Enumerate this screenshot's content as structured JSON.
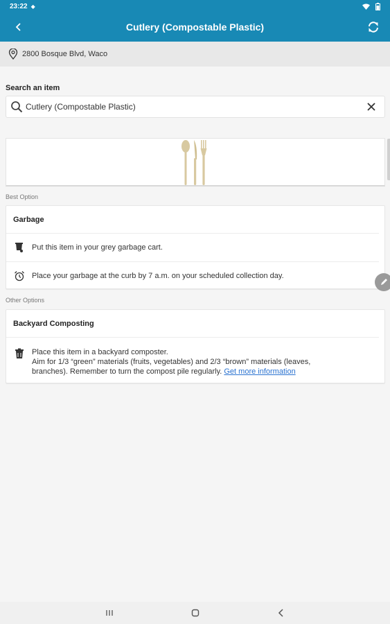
{
  "status": {
    "time": "23:22"
  },
  "header": {
    "title": "Cutlery (Compostable Plastic)"
  },
  "address": "2800 Bosque Blvd, Waco",
  "search": {
    "label": "Search an item",
    "value": "Cutlery (Compostable Plastic)",
    "placeholder": "Search an item"
  },
  "best": {
    "section_label": "Best Option",
    "title": "Garbage",
    "rows": [
      {
        "icon": "garbage-cart-icon",
        "text": "Put this item in your grey garbage cart."
      },
      {
        "icon": "alarm-clock-icon",
        "text": "Place your garbage at the curb by 7 a.m. on your scheduled collection day."
      }
    ]
  },
  "other": {
    "section_label": "Other Options",
    "title": "Backyard Composting",
    "line1": "Place this item in a backyard composter.",
    "line2": "Aim for 1/3 “green” materials (fruits, vegetables) and 2/3 “brown” materials (leaves,",
    "line3": "branches). Remember to turn the compost pile regularly.",
    "link": "Get more information"
  },
  "colors": {
    "accent": "#1889b5",
    "link": "#2a72d0"
  }
}
